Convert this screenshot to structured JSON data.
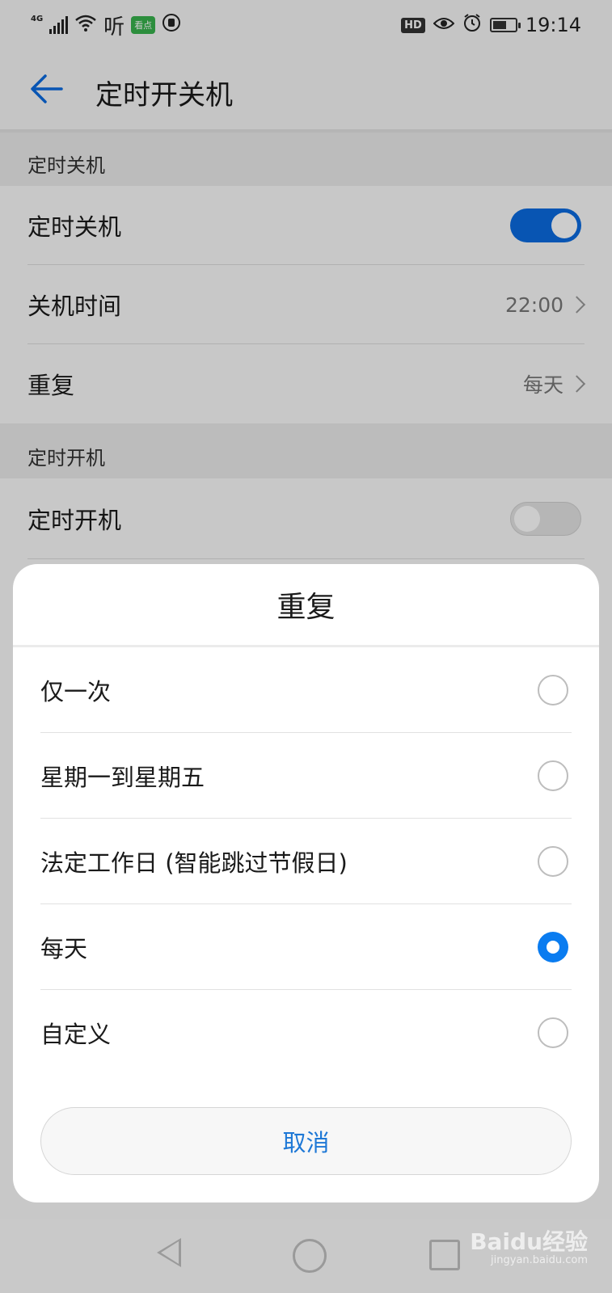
{
  "status_bar": {
    "network": "4G",
    "app_text": "听",
    "app_badge": "看点",
    "hd": "HD",
    "time": "19:14"
  },
  "app_bar": {
    "title": "定时开关机"
  },
  "shutdown_section": {
    "header": "定时关机",
    "toggle_label": "定时关机",
    "toggle_on": true,
    "time_label": "关机时间",
    "time_value": "22:00",
    "repeat_label": "重复",
    "repeat_value": "每天"
  },
  "boot_section": {
    "header": "定时开机",
    "toggle_label": "定时开机",
    "toggle_on": false
  },
  "dialog": {
    "title": "重复",
    "options": [
      {
        "label": "仅一次",
        "selected": false
      },
      {
        "label": "星期一到星期五",
        "selected": false
      },
      {
        "label": "法定工作日 (智能跳过节假日)",
        "selected": false
      },
      {
        "label": "每天",
        "selected": true
      },
      {
        "label": "自定义",
        "selected": false
      }
    ],
    "cancel_label": "取消"
  },
  "watermark": {
    "brand": "Baidu经验",
    "url": "jingyan.baidu.com"
  },
  "colors": {
    "accent": "#0a7cf0",
    "toggle_on": "#0a6be0",
    "cancel_text": "#1e78d6"
  }
}
